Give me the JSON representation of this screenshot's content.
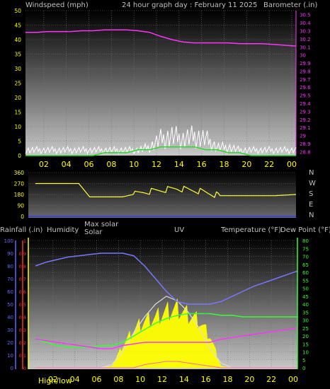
{
  "colors": {
    "background": "#000000",
    "gust": "#ffffff",
    "wind_avg": "#22dd22",
    "barometer": "#ff33ff",
    "direction": "#ffff33",
    "humidity": "#7777ff",
    "solar_max": "#dddddd",
    "solar": "#ffff00",
    "uv": "#ff66aa",
    "temperature": "#ff33ff",
    "dew_point": "#33ff33",
    "rainfall": "#cc0000",
    "axis_yellow": "#ffff00",
    "axis_green": "#33ff33",
    "axis_magenta": "#ff33ff",
    "axis_red": "#ff3333",
    "axis_blue": "#6666ff"
  },
  "chart_data": [
    {
      "type": "line",
      "title": "24 hour graph day : February 11 2025",
      "ylabel_left": "Windspeed (mph)",
      "ylabel_right": "Barometer (.in)",
      "x_ticks": [
        "02",
        "04",
        "06",
        "08",
        "10",
        "12",
        "14",
        "16",
        "18",
        "20",
        "22",
        "00"
      ],
      "y_ticks_left": [
        "0",
        "5",
        "10",
        "15",
        "20",
        "25",
        "30",
        "35",
        "40",
        "45",
        "50"
      ],
      "ylim_left": [
        0,
        50
      ],
      "y_ticks_right": [
        "28.8",
        "28.9",
        "29",
        "29.1",
        "29.2",
        "29.3",
        "29.4",
        "29.5",
        "29.6",
        "29.7",
        "29.8",
        "29.9",
        "30",
        "30.1",
        "30.2",
        "30.3",
        "30.4",
        "30.5"
      ],
      "ylim_right": [
        28.75,
        30.55
      ],
      "x": [
        "00",
        "01",
        "02",
        "03",
        "04",
        "05",
        "06",
        "07",
        "08",
        "09",
        "10",
        "11",
        "12",
        "13",
        "14",
        "15",
        "16",
        "17",
        "18",
        "19",
        "20",
        "21",
        "22",
        "23",
        "24"
      ],
      "series": [
        {
          "values": [
            2,
            2,
            2,
            2,
            2,
            2,
            2,
            2,
            2,
            2,
            2,
            3,
            6,
            7,
            6,
            7,
            6,
            3,
            3,
            2,
            2,
            2,
            2,
            2,
            2
          ]
        },
        {
          "values": [
            0,
            0,
            0,
            0,
            0,
            0,
            0,
            1,
            1,
            1,
            2,
            2,
            3,
            3,
            3,
            3,
            2,
            2,
            1,
            1,
            0,
            0,
            0,
            0,
            0
          ]
        },
        {
          "values": [
            30.28,
            30.28,
            30.29,
            30.29,
            30.29,
            30.3,
            30.3,
            30.31,
            30.31,
            30.31,
            30.3,
            30.28,
            30.23,
            30.19,
            30.16,
            30.15,
            30.15,
            30.15,
            30.15,
            30.14,
            30.14,
            30.14,
            30.13,
            30.12,
            30.11
          ]
        }
      ]
    },
    {
      "type": "line",
      "y_ticks": [
        "0",
        "90",
        "180",
        "270",
        "360"
      ],
      "ylim": [
        0,
        360
      ],
      "compass": [
        "N",
        "W",
        "S",
        "E",
        "N"
      ],
      "x": [
        "00",
        "01",
        "02",
        "03",
        "04",
        "05",
        "06",
        "07",
        "08",
        "09",
        "10",
        "11",
        "12",
        "13",
        "14",
        "15",
        "16",
        "17",
        "18",
        "19",
        "20",
        "21",
        "22",
        "23",
        "24"
      ],
      "values": [
        270,
        270,
        270,
        270,
        270,
        160,
        160,
        160,
        160,
        180,
        200,
        210,
        220,
        230,
        220,
        210,
        190,
        170,
        170,
        170,
        170,
        170,
        170,
        175,
        180
      ]
    },
    {
      "type": "line",
      "labels": {
        "rainfall": "Rainfall (.in)",
        "humidity": "Humidity",
        "max_solar": "Max solar",
        "solar": "Solar",
        "uv": "UV",
        "temperature": "Temperature (°F)",
        "dew_point": "Dew Point (°F)",
        "hi_lo": "High/low"
      },
      "x_ticks": [
        "02",
        "04",
        "06",
        "08",
        "10",
        "12",
        "14",
        "16",
        "18",
        "20",
        "22",
        "00"
      ],
      "y_ticks_rain": [
        "0",
        "0.1",
        "0.2",
        "0.3",
        "0.4",
        "0.5",
        "0.6",
        "0.7",
        "0.8",
        "0.9",
        "1"
      ],
      "y_ticks_humidity": [
        "0",
        "10",
        "20",
        "30",
        "40",
        "50",
        "60",
        "70",
        "80",
        "90",
        "100"
      ],
      "y_ticks_temp": [
        "0",
        "5",
        "10",
        "15",
        "20",
        "25",
        "30",
        "35",
        "40",
        "45",
        "50",
        "55",
        "60",
        "65",
        "70",
        "75",
        "80"
      ],
      "ylim_temp": [
        0,
        80
      ],
      "x": [
        "00",
        "01",
        "02",
        "03",
        "04",
        "05",
        "06",
        "07",
        "08",
        "09",
        "10",
        "11",
        "12",
        "13",
        "14",
        "15",
        "16",
        "17",
        "18",
        "19",
        "20",
        "21",
        "22",
        "23",
        "24"
      ],
      "humidity": [
        80,
        83,
        85,
        87,
        88,
        89,
        90,
        90,
        90,
        88,
        80,
        70,
        60,
        52,
        50,
        50,
        50,
        52,
        56,
        60,
        64,
        67,
        70,
        73,
        76
      ],
      "temperature": [
        18,
        17,
        16,
        15,
        14,
        13,
        12,
        12,
        14,
        15,
        16,
        16,
        16,
        16,
        16,
        16,
        16,
        18,
        19,
        20,
        21,
        22,
        23,
        24,
        25
      ],
      "dew_point": [
        18,
        16,
        14,
        13,
        13,
        13,
        14,
        14,
        16,
        20,
        24,
        28,
        31,
        33,
        34,
        34,
        34,
        33,
        33,
        32,
        32,
        32,
        32,
        32,
        32
      ],
      "solar_max": [
        0,
        0,
        0,
        0,
        0,
        0,
        0,
        2,
        10,
        22,
        32,
        40,
        45,
        42,
        35,
        25,
        12,
        3,
        0,
        0,
        0,
        0,
        0,
        0,
        0
      ],
      "solar": [
        0,
        0,
        0,
        0,
        0,
        0,
        0,
        1,
        14,
        24,
        30,
        32,
        36,
        38,
        34,
        30,
        20,
        1,
        0,
        0,
        0,
        0,
        0,
        0,
        0
      ],
      "uv_max": [
        0,
        0,
        0,
        0,
        0,
        0,
        0,
        0,
        0,
        0,
        2,
        3,
        4,
        4,
        3,
        2,
        1,
        0,
        0,
        0,
        0,
        0,
        0,
        0,
        0
      ]
    }
  ]
}
